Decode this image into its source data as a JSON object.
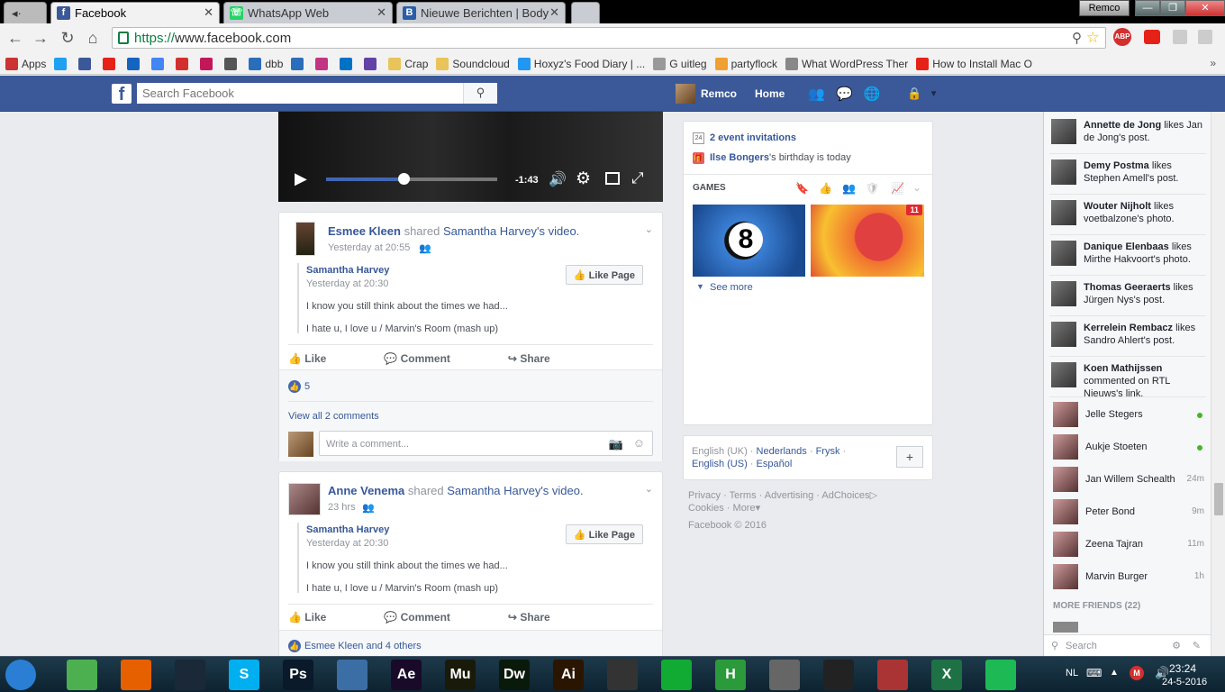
{
  "browser": {
    "tabs": [
      {
        "title": "Facebook",
        "active": true,
        "icon": "facebook-icon"
      },
      {
        "title": "WhatsApp Web",
        "active": false,
        "icon": "whatsapp-icon"
      },
      {
        "title": "Nieuwe Berichten | Body",
        "active": false,
        "icon": "body-icon"
      }
    ],
    "profile": "Remco",
    "url_scheme": "https://",
    "url_rest": "www.facebook.com",
    "bookmarks": [
      {
        "label": "Apps",
        "icon": "apps-grid-icon",
        "color": "#cc3333"
      },
      {
        "label": "",
        "icon": "twitter-icon",
        "color": "#1da1f2"
      },
      {
        "label": "",
        "icon": "facebook-icon",
        "color": "#3b5998"
      },
      {
        "label": "",
        "icon": "youtube-icon",
        "color": "#e62117"
      },
      {
        "label": "",
        "icon": "af-icon",
        "color": "#1565c0"
      },
      {
        "label": "",
        "icon": "google-icon",
        "color": "#4285f4"
      },
      {
        "label": "",
        "icon": "d-icon",
        "color": "#d32f2f"
      },
      {
        "label": "",
        "icon": "wp-icon",
        "color": "#c2185b"
      },
      {
        "label": "",
        "icon": "bookmark-icon",
        "color": "#555555"
      },
      {
        "label": "dbb",
        "icon": "dropbox-icon",
        "color": "#2a6ebb"
      },
      {
        "label": "",
        "icon": "dropbox-icon",
        "color": "#2a6ebb"
      },
      {
        "label": "",
        "icon": "instagram-icon",
        "color": "#c13584"
      },
      {
        "label": "",
        "icon": "outlook-icon",
        "color": "#0072c6"
      },
      {
        "label": "",
        "icon": "twitch-icon",
        "color": "#6441a5"
      },
      {
        "label": "Crap",
        "icon": "folder-icon",
        "color": "#e8c45a"
      },
      {
        "label": "Soundcloud",
        "icon": "folder-icon",
        "color": "#e8c45a"
      },
      {
        "label": "Hoxyz's Food Diary | ...",
        "icon": "food-icon",
        "color": "#2196f3"
      },
      {
        "label": "G uitleg",
        "icon": "page-icon",
        "color": "#999999"
      },
      {
        "label": "partyflock",
        "icon": "partyflock-icon",
        "color": "#f0a030"
      },
      {
        "label": "What WordPress Ther",
        "icon": "search-icon",
        "color": "#888888"
      },
      {
        "label": "How to Install Mac O",
        "icon": "youtube-icon",
        "color": "#e62117"
      }
    ]
  },
  "fb": {
    "search_placeholder": "Search Facebook",
    "user": "Remco",
    "home": "Home",
    "video": {
      "time": "-1:43",
      "progress": 0.45
    },
    "posts": [
      {
        "author": "Esmee Kleen",
        "verb": "shared",
        "target": "Samantha Harvey",
        "target_suffix": "'s video.",
        "time": "Yesterday at 20:55",
        "page": "Samantha Harvey",
        "page_time": "Yesterday at 20:30",
        "line1": "I know you still think about the times we had...",
        "line2": "I hate u, I love u / Marvin's Room (mash up)",
        "like_page": "Like Page",
        "like": "Like",
        "comment": "Comment",
        "share": "Share",
        "likes": "5",
        "view_comments": "View all 2 comments",
        "comment_placeholder": "Write a comment..."
      },
      {
        "author": "Anne Venema",
        "verb": "shared",
        "target": "Samantha Harvey",
        "target_suffix": "'s video.",
        "time": "23 hrs",
        "page": "Samantha Harvey",
        "page_time": "Yesterday at 20:30",
        "line1": "I know you still think about the times we had...",
        "line2": "I hate u, I love u / Marvin's Room (mash up)",
        "like_page": "Like Page",
        "like": "Like",
        "comment": "Comment",
        "share": "Share",
        "likes": "Esmee Kleen and 4 others"
      }
    ],
    "right": {
      "events": "2 event invitations",
      "birthday_name": "Ilse Bongers",
      "birthday_suffix": "'s birthday is today",
      "games_label": "GAMES",
      "game1": "8",
      "game2_badge": "11",
      "see_more": "See more",
      "languages": [
        "English (UK)",
        "Nederlands",
        "Frysk",
        "English (US)",
        "Español"
      ],
      "footer_links": [
        "Privacy",
        "Terms",
        "Advertising",
        "AdChoices",
        "Cookies",
        "More"
      ],
      "copyright": "Facebook © 2016"
    },
    "ticker": [
      {
        "name": "Annette de Jong",
        "action": " likes Jan de Jong's post."
      },
      {
        "name": "Demy Postma",
        "action": " likes Stephen Amell's post."
      },
      {
        "name": "Wouter Nijholt",
        "action": " likes voetbalzone's photo."
      },
      {
        "name": "Danique Elenbaas",
        "action": " likes Mirthe Hakvoort's photo."
      },
      {
        "name": "Thomas Geeraerts",
        "action": " likes Jürgen Nys's post."
      },
      {
        "name": "Kerrelein Rembacz",
        "action": " likes Sandro Ahlert's post."
      },
      {
        "name": "Koen Mathijssen",
        "action": " commented on RTL Nieuws's link."
      }
    ],
    "chat": [
      {
        "name": "Jelle Stegers",
        "status": "",
        "online": true
      },
      {
        "name": "Aukje Stoeten",
        "status": "",
        "online": true
      },
      {
        "name": "Jan Willem Schealth",
        "status": "24m",
        "online": false
      },
      {
        "name": "Peter Bond",
        "status": "9m",
        "online": false
      },
      {
        "name": "Zeena Tajran",
        "status": "11m",
        "online": false
      },
      {
        "name": "Marvin Burger",
        "status": "1h",
        "online": false
      }
    ],
    "more_friends": "MORE FRIENDS (22)",
    "chat_search": "Search"
  },
  "taskbar": {
    "apps": [
      {
        "icon": "start-orb-icon",
        "label": "",
        "color": "#2a7fd4"
      },
      {
        "icon": "chrome-icon",
        "label": "",
        "color": "#4caf50"
      },
      {
        "icon": "firefox-icon",
        "label": "",
        "color": "#e66000"
      },
      {
        "icon": "steam-icon",
        "label": "",
        "color": "#1b2838"
      },
      {
        "icon": "skype-icon",
        "label": "S",
        "color": "#00aff0"
      },
      {
        "icon": "photoshop-icon",
        "label": "Ps",
        "color": "#0a1a2a"
      },
      {
        "icon": "remote-icon",
        "label": "",
        "color": "#3a6ea5"
      },
      {
        "icon": "aftereffects-icon",
        "label": "Ae",
        "color": "#1a0a2a"
      },
      {
        "icon": "muse-icon",
        "label": "Mu",
        "color": "#1a1a0a"
      },
      {
        "icon": "dreamweaver-icon",
        "label": "Dw",
        "color": "#0a1a0a"
      },
      {
        "icon": "illustrator-icon",
        "label": "Ai",
        "color": "#2a1500"
      },
      {
        "icon": "film-icon",
        "label": "",
        "color": "#333"
      },
      {
        "icon": "app-icon",
        "label": "",
        "color": "#1a3"
      },
      {
        "icon": "h-app-icon",
        "label": "H",
        "color": "#2a9a3a"
      },
      {
        "icon": "ninety-nine-icon",
        "label": "",
        "color": "#666"
      },
      {
        "icon": "circle-app-icon",
        "label": "",
        "color": "#222"
      },
      {
        "icon": "game-icon",
        "label": "",
        "color": "#a33"
      },
      {
        "icon": "excel-icon",
        "label": "X",
        "color": "#1e7145"
      },
      {
        "icon": "spotify-icon",
        "label": "",
        "color": "#1db954"
      }
    ],
    "lang": "NL",
    "time": "23:24",
    "date": "24-5-2016"
  }
}
